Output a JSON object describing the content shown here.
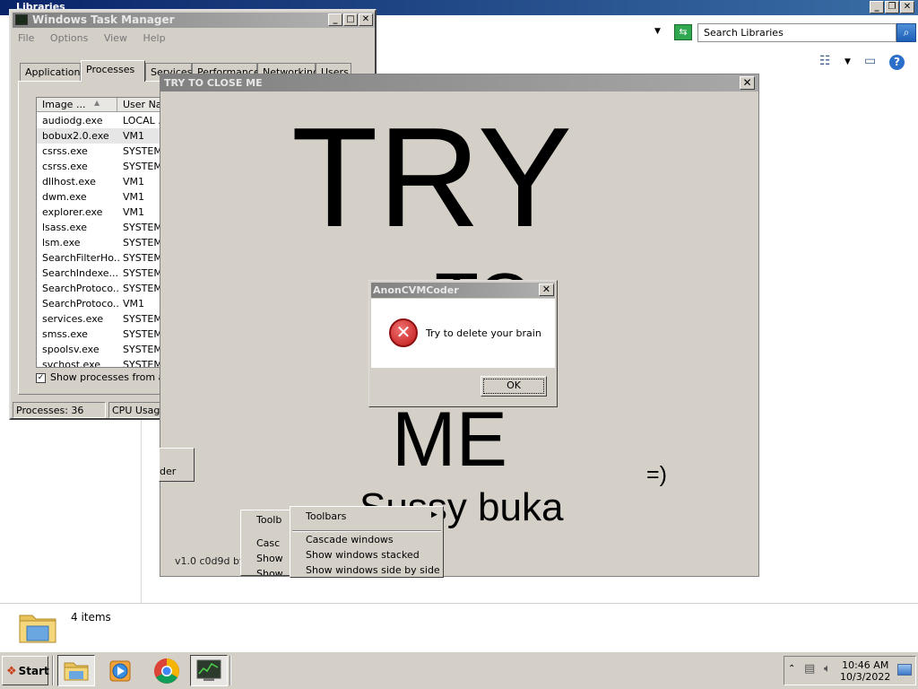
{
  "explorer": {
    "title": "Libraries",
    "search_placeholder": "Search Libraries",
    "status_items": "4 items",
    "window_buttons": {
      "minimize": "_",
      "restore": "❐",
      "close": "✕"
    }
  },
  "task_manager": {
    "title": "Windows Task Manager",
    "menu": [
      "File",
      "Options",
      "View",
      "Help"
    ],
    "tabs": [
      "Applications",
      "Processes",
      "Services",
      "Performance",
      "Networking",
      "Users"
    ],
    "active_tab": "Processes",
    "columns": [
      "Image ...",
      "User Nam"
    ],
    "processes": [
      {
        "name": "audiodg.exe",
        "user": "LOCAL ..."
      },
      {
        "name": "bobux2.0.exe",
        "user": "VM1"
      },
      {
        "name": "csrss.exe",
        "user": "SYSTEM"
      },
      {
        "name": "csrss.exe",
        "user": "SYSTEM"
      },
      {
        "name": "dllhost.exe",
        "user": "VM1"
      },
      {
        "name": "dwm.exe",
        "user": "VM1"
      },
      {
        "name": "explorer.exe",
        "user": "VM1"
      },
      {
        "name": "lsass.exe",
        "user": "SYSTEM"
      },
      {
        "name": "lsm.exe",
        "user": "SYSTEM"
      },
      {
        "name": "SearchFilterHo...",
        "user": "SYSTEM"
      },
      {
        "name": "SearchIndexe...",
        "user": "SYSTEM"
      },
      {
        "name": "SearchProtoco...",
        "user": "SYSTEM"
      },
      {
        "name": "SearchProtoco...",
        "user": "VM1"
      },
      {
        "name": "services.exe",
        "user": "SYSTEM"
      },
      {
        "name": "smss.exe",
        "user": "SYSTEM"
      },
      {
        "name": "spoolsv.exe",
        "user": "SYSTEM"
      },
      {
        "name": "svchost.exe",
        "user": "SYSTEM"
      }
    ],
    "selected_process": "bobux2.0.exe",
    "show_all_label": "Show processes from all u",
    "show_all_checked": true,
    "status_processes": "Processes: 36",
    "status_cpu": "CPU Usage"
  },
  "try_window": {
    "title": "TRY TO CLOSE ME",
    "close_glyph": "✕",
    "line_try": "TRY",
    "line_to": "TO",
    "line_me": "ME",
    "smiley": "=)",
    "line_sussy": "Sussy buka",
    "version": "v1.0 c0d9d by ...",
    "partial_button": "der"
  },
  "context_menu_back": {
    "items": [
      "Toolb",
      "Casc",
      "Show",
      "Show"
    ]
  },
  "context_menu": {
    "submenu": "Toolbars",
    "items": [
      "Cascade windows",
      "Show windows stacked",
      "Show windows side by side"
    ]
  },
  "message_box": {
    "title": "AnonCVMCoder",
    "close_glyph": "✕",
    "text": "Try to delete your brain",
    "ok_label": "OK",
    "icon": "error-icon"
  },
  "taskbar": {
    "start_label": "Start",
    "time": "10:46 AM",
    "date": "10/3/2022",
    "apps": [
      "folder-icon",
      "media-player-icon",
      "chrome-icon",
      "task-manager-icon"
    ]
  },
  "colors": {
    "window_face": "#d4d0c8",
    "inactive_title": "#808080",
    "error_red": "#c01818"
  }
}
